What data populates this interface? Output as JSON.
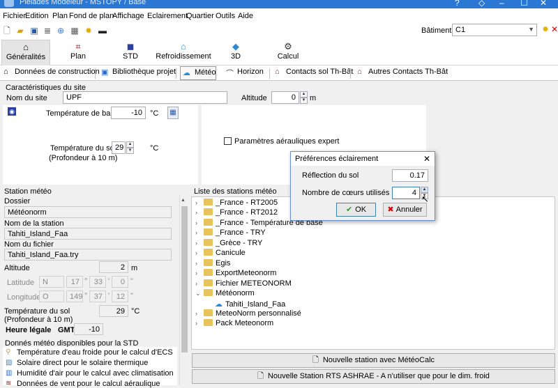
{
  "window": {
    "title": "Pleiades Modeleur - MSTOPY / Base",
    "min": "–",
    "restore": "◇",
    "max": "☐",
    "close": "✕"
  },
  "menu": [
    "Fichier",
    "Edition",
    "Plan",
    "Fond de plan",
    "Affichage",
    "Eclairement",
    "Quartier",
    "Outils",
    "Aide"
  ],
  "toolbar": {
    "batiment_label": "Bâtiment",
    "batiment_value": "C1"
  },
  "tabs": [
    {
      "label": "Généralités",
      "icon": "house-icon"
    },
    {
      "label": "Plan",
      "icon": "plan-icon"
    },
    {
      "label": "STD",
      "icon": "std-icon"
    },
    {
      "label": "Refroidissement",
      "icon": "cooling-icon"
    },
    {
      "label": "3D",
      "icon": "cube-icon"
    },
    {
      "label": "Calcul",
      "icon": "gears-icon"
    }
  ],
  "subtabs": [
    "Données de construction",
    "Bibliothèque projet",
    "Météo",
    "Horizon",
    "Contacts sol Th-Bât",
    "Autres Contacts Th-Bât"
  ],
  "site": {
    "section": "Caractéristiques du site",
    "nom_label": "Nom du site",
    "nom_value": "UPF",
    "altitude_label": "Altitude",
    "altitude_value": "0",
    "altitude_unit": "m",
    "temp_base_label": "Température de base",
    "temp_base_value": "-10",
    "temp_base_unit": "°C",
    "temp_sol_label": "Température du sol",
    "temp_sol_sub": "(Profondeur à 10 m)",
    "temp_sol_value": "29",
    "temp_sol_unit": "°C",
    "expert_label": "Paramètres aérauliques expert"
  },
  "station": {
    "section": "Station météo",
    "dossier_label": "Dossier",
    "dossier_value": "Météonorm",
    "nom_label": "Nom de la station",
    "nom_value": "Tahiti_Island_Faa",
    "fichier_label": "Nom du fichier",
    "fichier_value": "Tahiti_Island_Faa.try",
    "altitude_label": "Altitude",
    "altitude_value": "2",
    "altitude_unit": "m",
    "lat_label": "Latitude",
    "lat_dir": "N",
    "lat_deg": "17",
    "lat_min": "33",
    "lat_sec": "0",
    "lon_label": "Longitude",
    "lon_dir": "O",
    "lon_deg": "149",
    "lon_min": "37",
    "lon_sec": "12",
    "deg_sym": "°",
    "min_sym": "'",
    "sec_sym": "\"",
    "tsol_label": "Température du sol",
    "tsol_sub": "(Profondeur à 10 m)",
    "tsol_value": "29",
    "tsol_unit": "°C",
    "heure_label": "Heure légale",
    "gmt_label": "GMT",
    "gmt_value": "-10",
    "donnees_title": "Donnés météo disponibles pour la STD",
    "donnees": [
      "Température d'eau froide pour le calcul d'ECS",
      "Solaire direct pour le solaire thermique",
      "Humidité d'air pour le calcul avec climatisation",
      "Données de vent pour le calcul aéraulique"
    ]
  },
  "list": {
    "title": "Liste des stations météo",
    "items": [
      "_France - RT2005",
      "_France - RT2012",
      "_France - Température de base",
      "_France - TRY",
      "_Grèce - TRY",
      "Canicule",
      "Egis",
      "ExportMeteonorm",
      "Fichier METEONORM",
      "Météonorm",
      "Tahiti_Island_Faa",
      "MeteoNorm personnalisé",
      "Pack Meteonorm"
    ]
  },
  "buttons": {
    "new_meteocalc": "Nouvelle station avec MétéoCalc",
    "new_ashrae": "Nouvelle Station RTS ASHRAE - A n'utiliser que pour le dim. froid"
  },
  "dialog": {
    "title": "Préférences éclairement",
    "close": "✕",
    "reflection_label": "Réflection du sol",
    "reflection_value": "0.17",
    "cores_label": "Nombre de cœurs utilisés",
    "cores_value": "4",
    "ok": "OK",
    "cancel": "Annuler"
  }
}
